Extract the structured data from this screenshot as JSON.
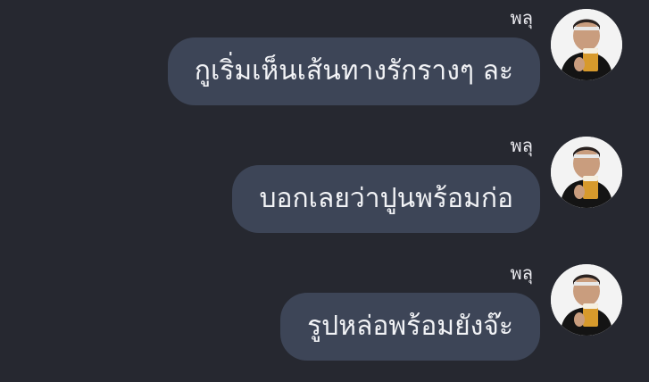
{
  "chat": {
    "messages": [
      {
        "sender": "พลุ",
        "text": "กูเริ่มเห็นเส้นทางรักรางๆ ละ",
        "avatar_icon": "user-avatar-photo"
      },
      {
        "sender": "พลุ",
        "text": "บอกเลยว่าปูนพร้อมก่อ",
        "avatar_icon": "user-avatar-photo"
      },
      {
        "sender": "พลุ",
        "text": "รูปหล่อพร้อมยังจ๊ะ",
        "avatar_icon": "user-avatar-photo"
      }
    ]
  },
  "colors": {
    "background": "#262830",
    "bubble": "#3d4557",
    "text": "#f2f3f6",
    "sender_text": "#e9e9ee"
  }
}
